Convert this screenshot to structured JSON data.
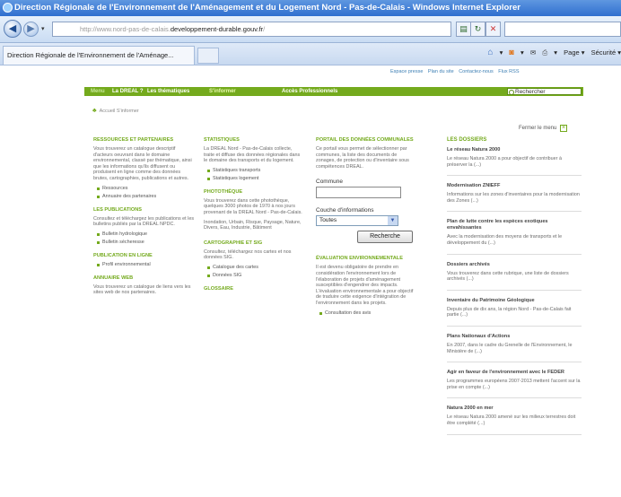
{
  "window": {
    "title": "Direction Régionale de l'Environnement de l'Aménagement et du Logement Nord - Pas-de-Calais - Windows Internet Explorer"
  },
  "addressbar": {
    "url_prefix": "http://www.nord-pas-de-calais.",
    "url_domain": "developpement-durable.gouv.fr",
    "url_suffix": "/"
  },
  "tabs": {
    "active_label": "Direction Régionale de l'Environnement de l'Aménage..."
  },
  "commandbar": {
    "page_label": "Page ▾",
    "safety_label": "Sécurité ▾"
  },
  "site": {
    "util_links": [
      "Espace presse",
      "Plan du site",
      "Contactez-nous",
      "Flux RSS"
    ],
    "nav": {
      "home": "Menu",
      "dreal": "La DREAL ?",
      "themes": "Les thématiques",
      "inform": "S'informer",
      "pros": "Accès Professionnels",
      "search_placeholder": "Rechercher"
    },
    "breadcrumb": "Accueil S'informer",
    "close_menu": "Fermer le menu"
  },
  "col1": {
    "ressources_title": "RESSOURCES ET PARTENAIRES",
    "ressources_text": "Vous trouverez un catalogue descriptif d'acteurs oeuvrant dans le domaine environnemental, classé par thématique, ainsi que les informations qu'ils diffusent ou produisent en ligne comme des données brutes, cartographies, publications et autres.",
    "ressources_links": [
      "Ressources",
      "Annuaire des partenaires"
    ],
    "publications_title": "LES PUBLICATIONS",
    "publications_text": "Consultez et téléchargez les publications et les bulletins publiés par la DREAL NPDC.",
    "publications_links": [
      "Bulletin hydrologique",
      "Bulletin sécheresse"
    ],
    "online_title": "PUBLICATION EN LIGNE",
    "online_links": [
      "Profil environnemental"
    ],
    "annuaire_title": "ANNUAIRE WEB",
    "annuaire_text": "Vous trouverez un catalogue de liens vers les sites web de nos partenaires."
  },
  "col2": {
    "stats_title": "STATISTIQUES",
    "stats_text": "La DREAL Nord - Pas-de-Calais collecte, traite et diffuse des données régionales dans le domaine des transports et du logement.",
    "stats_links": [
      "Statistiques transports",
      "Statistiques logement"
    ],
    "photo_title": "PHOTOTHÈQUE",
    "photo_text": "Vous trouverez dans cette photothèque, quelques 3000 photos de 1970 à nos jours provenant de la DREAL Nord - Pas-de-Calais.",
    "photo_tags": "Inondation, Urbain, Risque, Paysage, Nature, Divers, Eau, Industrie, Bâtiment",
    "carto_title": "CARTOGRAPHIE ET SIG",
    "carto_text": "Consultez, téléchargez nos cartes et nos données SIG.",
    "carto_links": [
      "Catalogue des cartes",
      "Données SIG"
    ],
    "glossaire_title": "GLOSSAIRE"
  },
  "col3": {
    "portail_title": "PORTAIL DES DONNÉES COMMUNALES",
    "portail_text": "Ce portail vous permet de sélectionner par communes, la liste des documents de zonages, de protection ou d'inventaire sous compétences DREAL.",
    "commune_label": "Commune",
    "commune_value": "",
    "couche_label": "Couche d'informations",
    "couche_selected": "Toutes",
    "search_button": "Recherche",
    "eval_title": "ÉVALUATION ENVIRONNEMENTALE",
    "eval_text": "Il est devenu obligatoire de prendre en considération l'environnement lors de l'élaboration de projets d'aménagement susceptibles d'engendrer des impacts. L'évaluation environnementale a pour objectif de traduire cette exigence d'intégration de l'environnement dans les projets.",
    "eval_links": [
      "Consultation des avis"
    ]
  },
  "col4": {
    "title": "LES DOSSIERS",
    "items": [
      {
        "title": "Le réseau Natura 2000",
        "text": "Le réseau Natura 2000 a pour objectif de contribuer à préserver la (...)"
      },
      {
        "title": "Modernisation ZNIEFF",
        "text": "Informations sur les zones d'inventaires pour la modernisation des Zones (...)"
      },
      {
        "title": "Plan de lutte contre les espèces exotiques envahissantes",
        "text": "Avec la modernisation des moyens de transports et le développement du (...)"
      },
      {
        "title": "Dossiers archivés",
        "text": "Vous trouverez dans cette rubrique, une liste de dossiers archivés (...)"
      },
      {
        "title": "Inventaire du Patrimoine Géologique",
        "text": "Depuis plus de dix ans, la région Nord - Pas-de-Calais fait partie (...)"
      },
      {
        "title": "Plans Nationaux d'Actions",
        "text": "En 2007, dans le cadre du Grenelle de l'Environnement, le Ministère de (...)"
      },
      {
        "title": "Agir en faveur de l'environnement avec le FEDER",
        "text": "Les programmes européens 2007-2013 mettent l'accent sur la prise en compte (...)"
      },
      {
        "title": "Natura 2000 en mer",
        "text": "Le réseau Natura 2000 amené sur les milieux terrestres doit être complété (...)"
      }
    ]
  },
  "colors": {
    "accent_green": "#74aa1d",
    "ie_title_blue": "#2f6fcf",
    "link_blue": "#3d7fb4"
  }
}
